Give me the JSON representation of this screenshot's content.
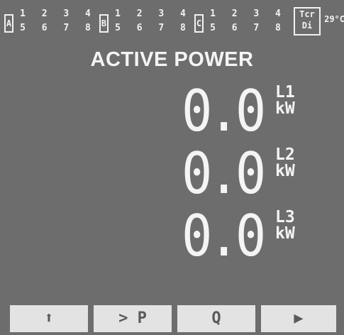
{
  "groups": [
    {
      "label": "A",
      "row1": [
        "1",
        "2",
        "3",
        "4"
      ],
      "row2": [
        "5",
        "6",
        "7",
        "8"
      ]
    },
    {
      "label": "B",
      "row1": [
        "1",
        "2",
        "3",
        "4"
      ],
      "row2": [
        "5",
        "6",
        "7",
        "8"
      ]
    },
    {
      "label": "C",
      "row1": [
        "1",
        "2",
        "3",
        "4"
      ],
      "row2": [
        "5",
        "6",
        "7",
        "8"
      ]
    }
  ],
  "tcr": {
    "line1": "Tcr",
    "line2": "Di"
  },
  "temperature": "29°C",
  "title": "ACTIVE POWER",
  "readings": [
    {
      "value": "0.0",
      "line": "L1",
      "unit": "kW"
    },
    {
      "value": "0.0",
      "line": "L2",
      "unit": "kW"
    },
    {
      "value": "0.0",
      "line": "L3",
      "unit": "kW"
    }
  ],
  "softkeys": [
    {
      "label": "⬆"
    },
    {
      "label": "> P"
    },
    {
      "label": "Q"
    },
    {
      "label": "▶"
    }
  ]
}
